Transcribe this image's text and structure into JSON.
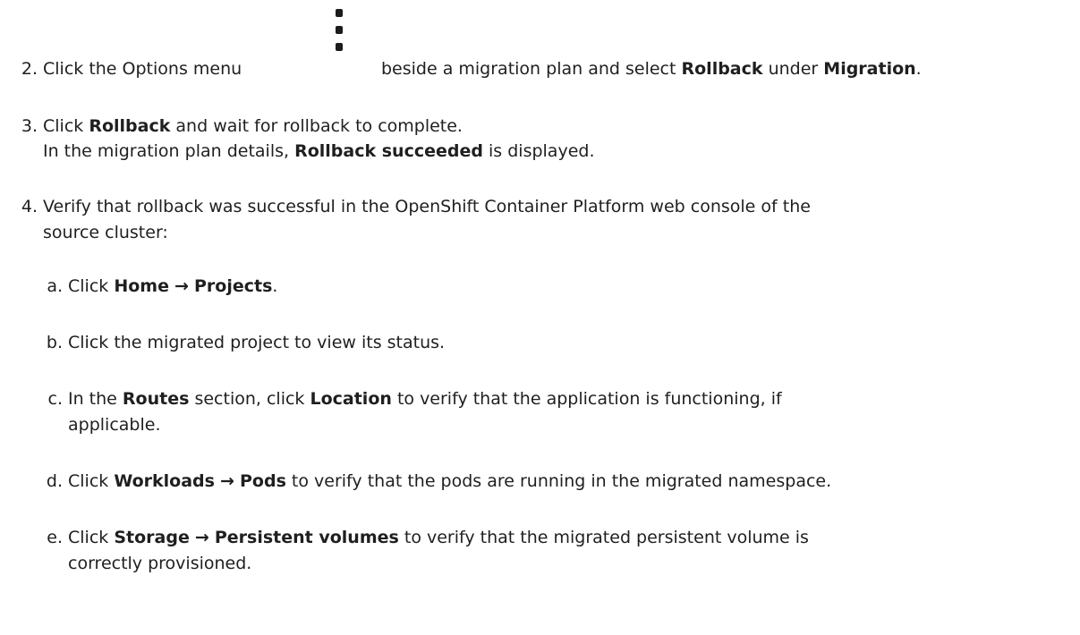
{
  "steps": {
    "s2": {
      "num": "2.",
      "t1": "Click the Options menu",
      "t2": "beside a migration plan and select",
      "b1": "Rollback",
      "t3": "under",
      "b2": "Migration",
      "t4": "."
    },
    "s3": {
      "num": "3.",
      "t1": "Click",
      "b1": "Rollback",
      "t2": "and wait for rollback to complete.",
      "l2a": "In the migration plan details,",
      "b2": "Rollback succeeded",
      "l2b": "is displayed."
    },
    "s4": {
      "num": "4.",
      "line1": "Verify that rollback was successful in the OpenShift Container Platform web console of the",
      "line2": "source cluster:",
      "a": {
        "letter": "a.",
        "t1": "Click",
        "b1": "Home",
        "arrow": "→",
        "b2": "Projects",
        "t2": "."
      },
      "b": {
        "letter": "b.",
        "t1": "Click the migrated project to view its status."
      },
      "c": {
        "letter": "c.",
        "t1": "In the",
        "b1": "Routes",
        "t2": "section, click",
        "b2": "Location",
        "t3": "to verify that the application is functioning, if",
        "line2": "applicable."
      },
      "d": {
        "letter": "d.",
        "t1": "Click",
        "b1": "Workloads",
        "arrow": "→",
        "b2": "Pods",
        "t2": "to verify that the pods are running in the migrated namespace."
      },
      "e": {
        "letter": "e.",
        "t1": "Click",
        "b1": "Storage",
        "arrow": "→",
        "b2": "Persistent volumes",
        "t2": "to verify that the migrated persistent volume is",
        "line2": "correctly provisioned."
      }
    }
  },
  "icons": {
    "options_menu": "kebab-vertical-icon"
  }
}
